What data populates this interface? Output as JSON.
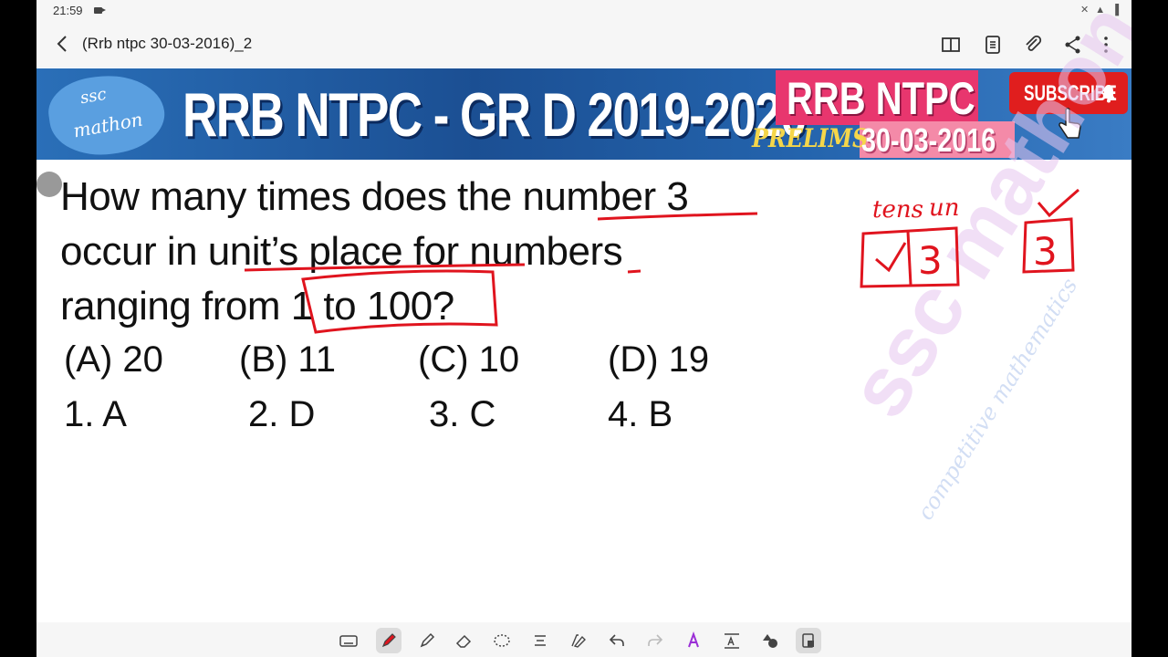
{
  "status_bar": {
    "time": "21:59",
    "icons": "✕ ▲ ▐"
  },
  "app_bar": {
    "title": "(Rrb ntpc 30-03-2016)_2"
  },
  "banner": {
    "logo_line1": "ssc",
    "logo_line2": "mathon",
    "headline": "RRB NTPC - GR D 2019-2020",
    "badge_title": "RRB NTPC",
    "badge_prelims": "PRELIMS",
    "badge_date": "30-03-2016",
    "subscribe_label": "SUBSCRIBE"
  },
  "question": {
    "line1": "How many times does the number 3",
    "line2": "occur in unit’s place for numbers",
    "line3": "ranging from 1 to 100?",
    "options": [
      "(A) 20",
      "(B) 11",
      "(C) 10",
      "(D) 19"
    ],
    "answers": [
      "1. A",
      "2. D",
      "3. C",
      "4. B"
    ]
  },
  "annotations": {
    "tens_label": "tens",
    "units_label": "un",
    "digit": "3"
  },
  "watermark": {
    "main": "ssc mathon",
    "sub": "competitive mathematics"
  },
  "colors": {
    "ink": "#e0141e",
    "banner": "#1b4f93",
    "subscribe": "#e01e1e"
  }
}
